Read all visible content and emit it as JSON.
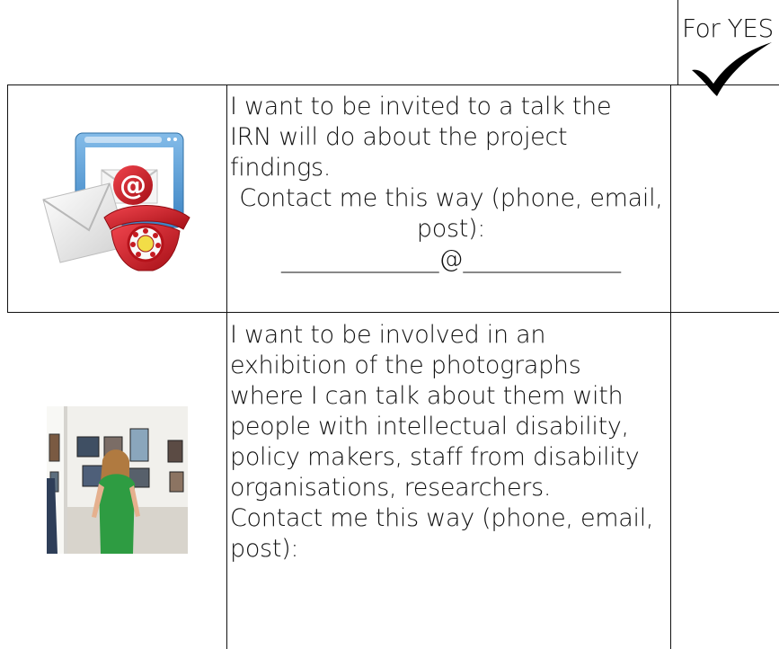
{
  "table": {
    "header": {
      "yes_column_label": "For YES"
    },
    "rows": [
      {
        "text_lines": [
          "I want to be invited to a talk the",
          "IRN will do about the project",
          "findings."
        ],
        "contact_line_1": "Contact me this way (phone, email,",
        "contact_line_2": "post):",
        "blank_line": "_____________@_____________"
      },
      {
        "text_lines": [
          "I want to be involved in an",
          "exhibition of the photographs",
          "where I can talk about them with",
          "people with intellectual disability,",
          "policy makers, staff from disability",
          "organisations, researchers."
        ],
        "contact_line_1": "Contact me this way (phone, email,",
        "contact_line_2": "post):"
      }
    ]
  },
  "colors": {
    "border": "#111111",
    "check": "#000000",
    "envelope_red": "#d71920",
    "dress_green": "#2f9b3e"
  },
  "icons": {
    "row_1": "email-phone-icon",
    "row_2": "exhibition-photo",
    "header": "checkmark-icon"
  }
}
